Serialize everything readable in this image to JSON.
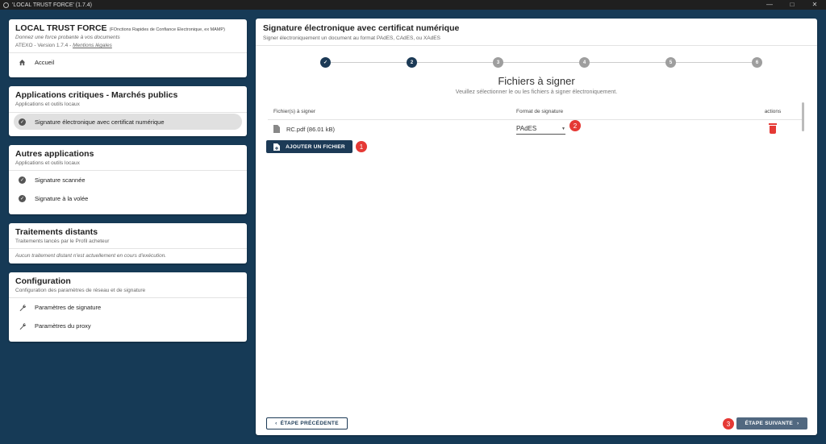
{
  "window": {
    "title": "'LOCAL TRUST FORCE' (1.7.4)",
    "controls": [
      "—",
      "□",
      "✕"
    ]
  },
  "app_card": {
    "title": "LOCAL TRUST FORCE",
    "title_note": "(FOnctions Rapides de Confiance Electronique, ex MAMP)",
    "tagline": "Donnez une force probante à vos documents",
    "version": "ATEXO - Version 1.7.4 -",
    "legal_link": "Mentions légales",
    "home_label": "Accueil"
  },
  "critical_apps": {
    "title": "Applications critiques - Marchés publics",
    "subtitle": "Applications et outils locaux",
    "items": [
      {
        "label": "Signature électronique avec certificat numérique",
        "active": true
      }
    ]
  },
  "other_apps": {
    "title": "Autres applications",
    "subtitle": "Applications et outils locaux",
    "items": [
      {
        "label": "Signature scannée"
      },
      {
        "label": "Signature à la volée"
      }
    ]
  },
  "remote": {
    "title": "Traitements distants",
    "subtitle": "Traitements lancés par le Profil acheteur",
    "empty_text": "Aucun traitement distant n'est actuellement en cours d'exécution."
  },
  "config": {
    "title": "Configuration",
    "subtitle": "Configuration des paramètres de réseau et de signature",
    "items": [
      {
        "label": "Paramètres de signature"
      },
      {
        "label": "Paramètres du proxy"
      }
    ]
  },
  "main": {
    "title": "Signature électronique avec certificat numérique",
    "subtitle": "Signer électroniquement un document au format PAdES, CAdES, ou XAdES",
    "steps": [
      "✓",
      "2",
      "3",
      "4",
      "5",
      "6"
    ],
    "current_step": 2,
    "section_title": "Fichiers à signer",
    "section_subtitle": "Veuillez sélectionner le ou les fichiers à signer électroniquement.",
    "table": {
      "headers": [
        "Fichier(s) à signer",
        "Format de signature",
        "actions"
      ],
      "rows": [
        {
          "file": "RC.pdf (86.01 kB)",
          "format": "PAdES"
        }
      ]
    },
    "add_file_label": "AJOUTER UN FICHIER",
    "prev_label": "ÉTAPE PRÉCÉDENTE",
    "next_label": "ÉTAPE SUIVANTE",
    "badges": [
      "1",
      "2",
      "3"
    ]
  },
  "colors": {
    "background": "#163a56",
    "primary": "#1c3a56",
    "badge": "#e53935",
    "next_button": "#516880"
  }
}
